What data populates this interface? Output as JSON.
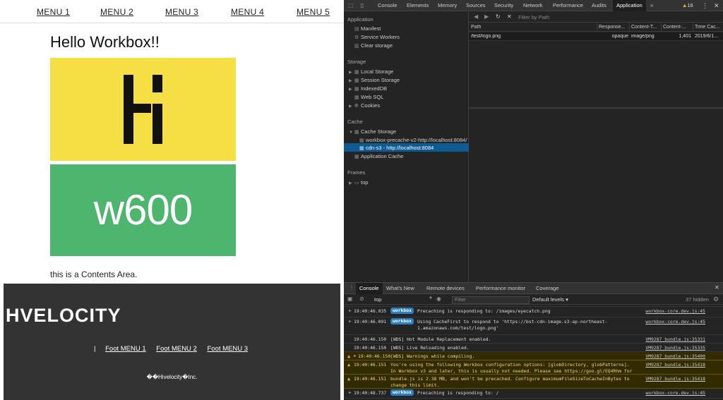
{
  "webpage": {
    "nav": [
      "MENU 1",
      "MENU 2",
      "MENU 3",
      "MENU 4",
      "MENU 5"
    ],
    "heading": "Hello Workbox!!",
    "green_block_text": "w600",
    "contents_text": "this is a Contents Area.",
    "footer": {
      "logo": "HVELOCITY",
      "separator": "|",
      "links": [
        "Foot MENU 1",
        "Foot MENU 2",
        "Foot MENU 3"
      ],
      "copyright": "��Hivelocity�Inc."
    },
    "colors": {
      "yellow": "#f6de45",
      "green": "#4db56d",
      "footer_bg": "#333333"
    }
  },
  "devtools": {
    "main_tabs": [
      "Console",
      "Elements",
      "Memory",
      "Sources",
      "Security",
      "Network",
      "Performance",
      "Audits",
      "Application"
    ],
    "active_tab": "Application",
    "more_tabs": "»",
    "warning_count": "16",
    "sidebar": {
      "application_heading": "Application",
      "application_items": [
        "Manifest",
        "Service Workers",
        "Clear storage"
      ],
      "storage_heading": "Storage",
      "storage_items": [
        "Local Storage",
        "Session Storage",
        "IndexedDB",
        "Web SQL",
        "Cookies"
      ],
      "cache_heading": "Cache",
      "cache_storage": "Cache Storage",
      "cache_entries": [
        "workbox-precache-v2-http://localhost:8084/",
        "cdn-s3 - http://localhost:8084"
      ],
      "application_cache": "Application Cache",
      "frames_heading": "Frames",
      "frames_items": [
        "top"
      ]
    },
    "cache_panel": {
      "filter_placeholder": "Filter by Path",
      "columns": [
        "Path",
        "Response...",
        "Content-T...",
        "Content-...",
        "Time Cac..."
      ],
      "rows": [
        {
          "path": "/test/logo.png",
          "response": "opaque",
          "content_type": "image/png",
          "content_length": "1,401",
          "time_cached": "2019/6/1..."
        }
      ]
    },
    "drawer": {
      "tabs": [
        "Console",
        "What's New",
        "Remote devices",
        "Performance monitor",
        "Coverage"
      ],
      "active_tab": "Console",
      "context": "top",
      "filter_placeholder": "Filter",
      "levels": "Default levels ▾",
      "hidden": "37 hidden",
      "log": [
        {
          "kind": "info",
          "arrow": true,
          "time": "19:40:46.035",
          "badge": "workbox",
          "msg": "Precaching is responding to: /images/eyecatch.png",
          "src": "workbox-core.dev.js:45"
        },
        {
          "kind": "info",
          "arrow": true,
          "time": "19:40:46.091",
          "badge": "workbox",
          "msg": "Using CacheFirst to respond to 'https://bst-cdn-image.s3-ap-northeast-1.amazonaws.com/test/logo.png'",
          "src": "workbox-core.dev.js:45"
        },
        {
          "kind": "info",
          "arrow": false,
          "time": "19:40:46.150",
          "badge": "",
          "msg": "[WDS] Hot Module Replacement enabled.",
          "src": "VM9287 bundle.js:35331"
        },
        {
          "kind": "info",
          "arrow": false,
          "time": "19:40:46.150",
          "badge": "",
          "msg": "[WDS] Live Reloading enabled.",
          "src": "VM9287 bundle.js:35335"
        },
        {
          "kind": "warn",
          "arrow": true,
          "time": "19:40:46.150",
          "badge": "",
          "msg": "[WDS] Warnings while compiling.",
          "src": "VM9287 bundle.js:35400"
        },
        {
          "kind": "warn",
          "arrow": false,
          "time": "19:40:46.151",
          "badge": "",
          "msg": "You're using the following Workbox configuration options: [globDirectory, globPatterns]. In Workbox v3 and later, this is usually not needed. Please see https://goo.gl/EQ4Rhm for more info.",
          "src": "VM9287 bundle.js:35418"
        },
        {
          "kind": "warn",
          "arrow": false,
          "time": "19:40:46.151",
          "badge": "",
          "msg": "bundle.js is 2.38 MB, and won't be precached. Configure maximumFileSizeToCacheInBytes to change this limit.",
          "src": "VM9287 bundle.js:35418"
        },
        {
          "kind": "info",
          "arrow": true,
          "time": "19:40:48.737",
          "badge": "workbox",
          "msg": "Precaching is responding to: /",
          "src": "workbox-core.dev.js:45"
        }
      ]
    }
  }
}
